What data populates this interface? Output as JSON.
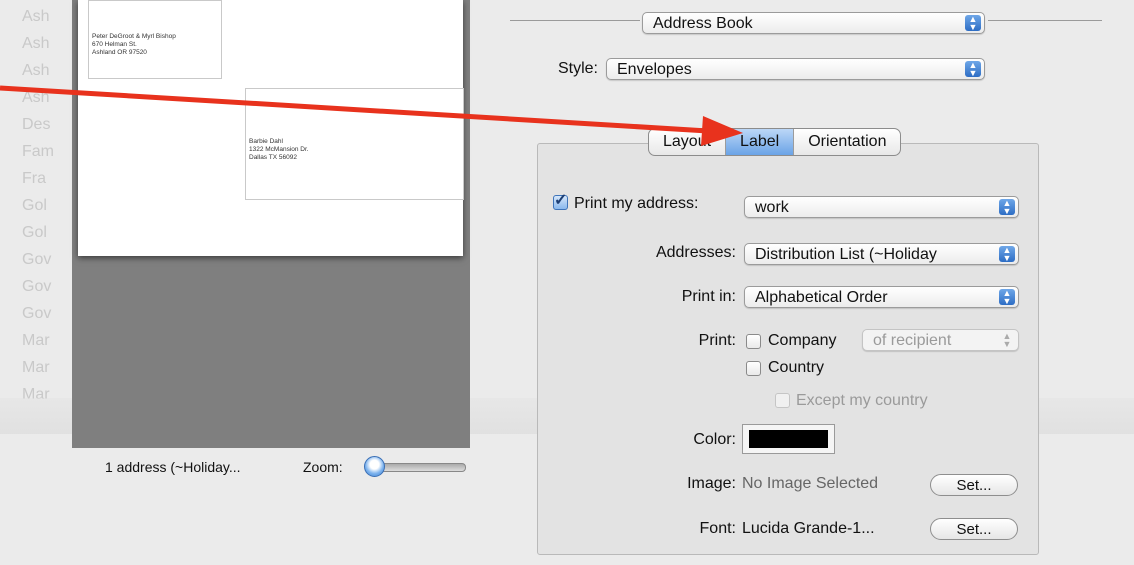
{
  "background_rows": [
    "Ash",
    "Ash",
    "Ash",
    "Ash",
    "Des",
    "Fam",
    "Fra",
    "Gol",
    "Gol",
    "Gov",
    "Gov",
    "Gov",
    "Mar",
    "Mar",
    "Mar"
  ],
  "preview": {
    "return_address": "Peter DeGroot & Myrl Bishop\n670 Helman St.\nAshland OR 97520",
    "recipient_address": "Barbie Dahl\n1322 McMansion Dr.\nDallas TX 56092",
    "address_count": "1 address (~Holiday...",
    "zoom_label": "Zoom:",
    "zoom_level": 0.0
  },
  "top_popup": {
    "value": "Address Book"
  },
  "style": {
    "label": "Style:",
    "value": "Envelopes"
  },
  "tabs": [
    {
      "label": "Layout",
      "active": false
    },
    {
      "label": "Label",
      "active": true
    },
    {
      "label": "Orientation",
      "active": false
    }
  ],
  "form": {
    "print_my_address": {
      "label": "Print my address:",
      "checked": true,
      "value": "work"
    },
    "addresses": {
      "label": "Addresses:",
      "value": "Distribution List (~Holiday"
    },
    "print_in": {
      "label": "Print in:",
      "value": "Alphabetical Order"
    },
    "print": {
      "label": "Print:",
      "company_label": "Company",
      "company_scope": "of recipient",
      "country_label": "Country",
      "except_label": "Except my country"
    },
    "color": {
      "label": "Color:",
      "value": "#000000"
    },
    "image": {
      "label": "Image:",
      "value": "No Image Selected",
      "button": "Set..."
    },
    "font": {
      "label": "Font:",
      "value": "Lucida Grande-1...",
      "button": "Set..."
    }
  },
  "colors": {
    "annotation_arrow": "#e8321d",
    "accent": "#3a7fd0"
  },
  "icons": {
    "popup_arrows": "up-down-arrows-icon",
    "zoom_knob": "slider-knob-icon"
  }
}
